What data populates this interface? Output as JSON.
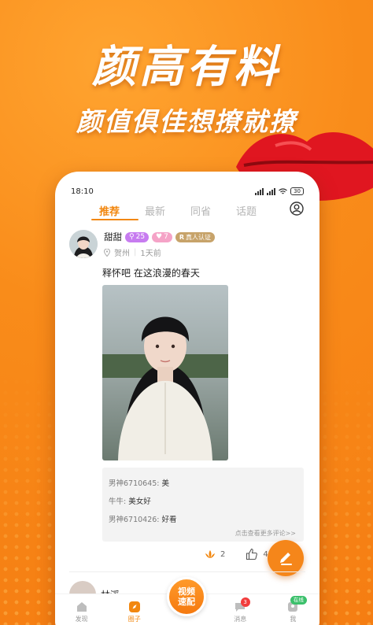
{
  "promo": {
    "headline": "颜高有料",
    "subline": "颜值俱佳想撩就撩"
  },
  "status_bar": {
    "time": "18:10",
    "battery": "30"
  },
  "tabs": [
    {
      "label": "推荐",
      "active": true
    },
    {
      "label": "最新",
      "active": false
    },
    {
      "label": "同省",
      "active": false
    },
    {
      "label": "话题",
      "active": false
    }
  ],
  "post": {
    "username": "甜甜",
    "level_badge": "25",
    "heart_badge": "7",
    "verified_badge": "真人认证",
    "location": "贺州",
    "time_ago": "1天前",
    "text": "释怀吧 在这浪漫的春天",
    "comments": [
      {
        "user": "男神6710645:",
        "text": "美"
      },
      {
        "user": "牛牛:",
        "text": "美女好"
      },
      {
        "user": "男神6710426:",
        "text": "好看"
      }
    ],
    "more_comments": "点击查看更多评论>>",
    "gift_count": "2",
    "like_count": "43"
  },
  "next_post": {
    "username": "林溪"
  },
  "bottom_nav": {
    "items": [
      {
        "label": "发现",
        "active": false
      },
      {
        "label": "圈子",
        "active": true
      },
      {
        "label": "消息",
        "active": false,
        "badge": "3"
      },
      {
        "label": "我",
        "active": false,
        "badge": "在线"
      }
    ],
    "center_label_1": "视频",
    "center_label_2": "速配"
  },
  "colors": {
    "accent": "#f2870f",
    "background": "#f98a16"
  }
}
